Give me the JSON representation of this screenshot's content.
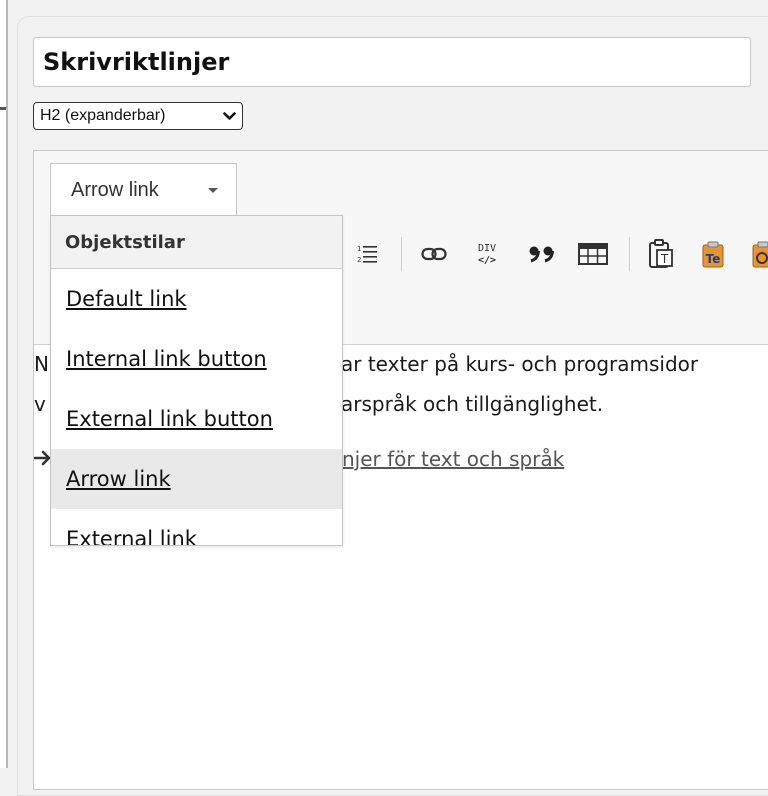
{
  "document": {
    "title": "Skrivriktlinjer",
    "heading_select": {
      "selected": "H2 (expanderbar)"
    }
  },
  "toolbar": {
    "style_combo": {
      "value": "Arrow link"
    },
    "icons": [
      "numbered-list-icon",
      "link-icon",
      "div-icon",
      "blockquote-icon",
      "table-icon",
      "paste-text-icon",
      "paste-word-icon",
      "paste-special-icon"
    ]
  },
  "style_dropdown": {
    "header": "Objektstilar",
    "items": [
      {
        "label": "Default link",
        "active": false
      },
      {
        "label": "Internal link button",
        "active": false
      },
      {
        "label": "External link button",
        "active": false
      },
      {
        "label": "Arrow link",
        "active": true
      },
      {
        "label": "External link",
        "active": false
      }
    ]
  },
  "content": {
    "line1_lead": "N",
    "line1_rest": "ar texter på kurs- och programsidor",
    "line2_lead": "v",
    "line2_rest": "arspråk och tillgänglighet.",
    "link_text": "njer för text och språk"
  },
  "colors": {
    "accent_active_item": "#e9e9e9",
    "link": "#555555",
    "paste_word_icon": "#e8952e"
  }
}
